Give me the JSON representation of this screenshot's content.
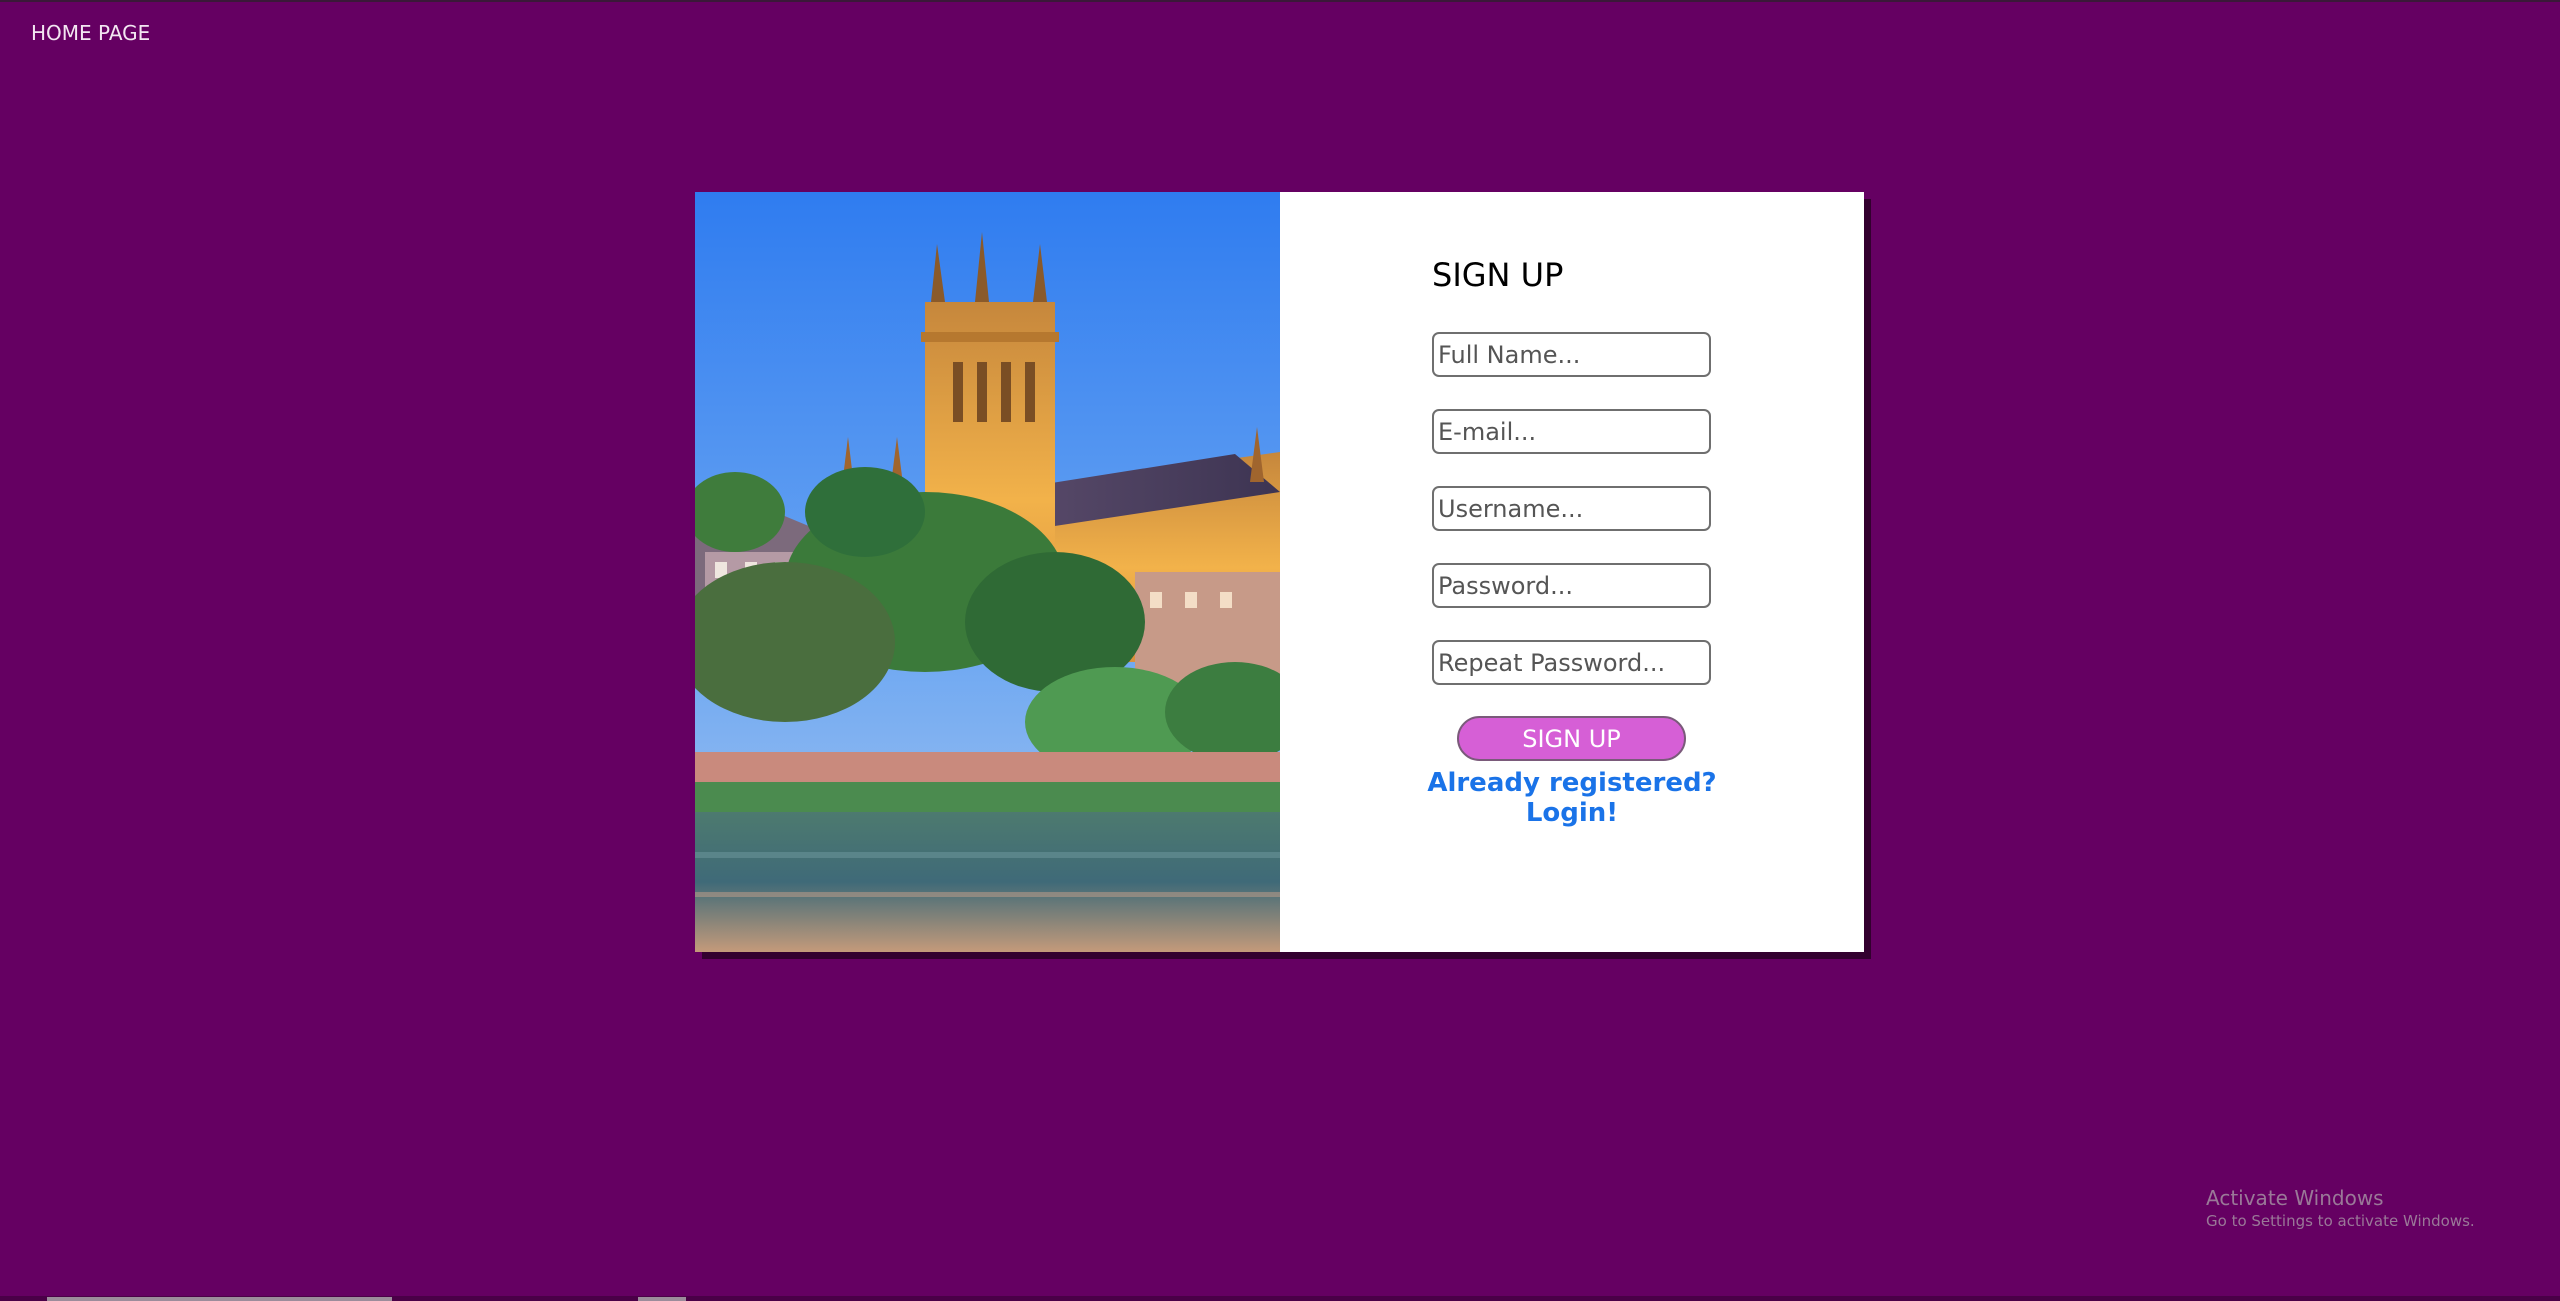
{
  "nav": {
    "home_label": "HOME PAGE"
  },
  "image": {
    "alt": "Cathedral by the river"
  },
  "form": {
    "title": "SIGN UP",
    "full_name_placeholder": "Full Name...",
    "email_placeholder": "E-mail...",
    "username_placeholder": "Username...",
    "password_placeholder": "Password...",
    "repeat_password_placeholder": "Repeat Password...",
    "submit_label": "SIGN UP",
    "login_link": "Already registered? Login!"
  },
  "watermark": {
    "line1": "Activate Windows",
    "line2": "Go to Settings to activate Windows."
  },
  "colors": {
    "background": "#650062",
    "button": "#d65fd6",
    "link": "#1a73e8"
  }
}
